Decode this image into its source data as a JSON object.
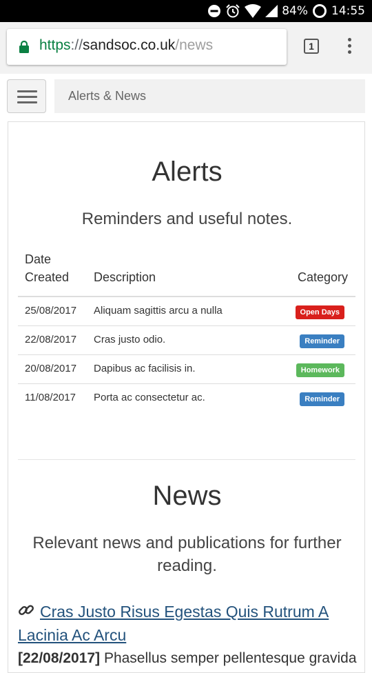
{
  "status_bar": {
    "battery": "84%",
    "time": "14:55"
  },
  "browser": {
    "url_scheme": "https",
    "url_sep": "://",
    "url_host": "sandsoc.co.uk",
    "url_path": "/news",
    "tab_count": "1"
  },
  "header": {
    "breadcrumb": "Alerts & News"
  },
  "alerts": {
    "title": "Alerts",
    "subtitle": "Reminders and useful notes.",
    "columns": {
      "date_line1": "Date",
      "date_line2": "Created",
      "description": "Description",
      "category": "Category"
    },
    "rows": [
      {
        "date": "25/08/2017",
        "description": "Aliquam sagittis arcu a nulla",
        "category": "Open Days",
        "color": "#d9201c"
      },
      {
        "date": "22/08/2017",
        "description": "Cras justo odio.",
        "category": "Reminder",
        "color": "#3a7fc1"
      },
      {
        "date": "20/08/2017",
        "description": "Dapibus ac facilisis in.",
        "category": "Homework",
        "color": "#5cb85c"
      },
      {
        "date": "11/08/2017",
        "description": "Porta ac consectetur ac.",
        "category": "Reminder",
        "color": "#3a7fc1"
      }
    ]
  },
  "news": {
    "title": "News",
    "subtitle": "Relevant news and publications for further reading.",
    "items": [
      {
        "title": "Cras Justo Risus Egestas Quis Rutrum A Lacinia Ac Arcu",
        "date": "[22/08/2017]",
        "excerpt": "Phasellus semper pellentesque gravida"
      }
    ]
  }
}
